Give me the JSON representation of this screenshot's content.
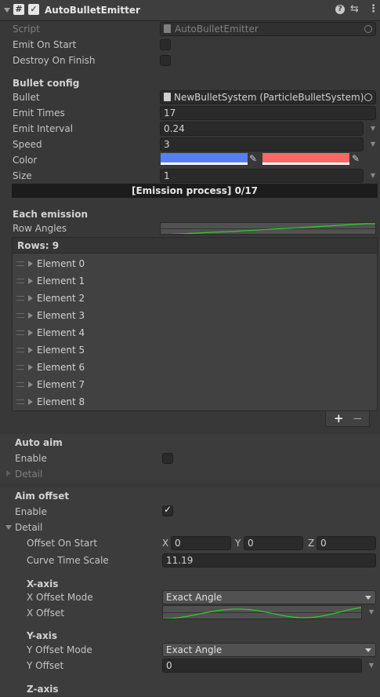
{
  "component": {
    "title": "AutoBulletEmitter",
    "script_label": "Script",
    "script_value": "AutoBulletEmitter"
  },
  "base": {
    "emit_on_start_label": "Emit On Start",
    "emit_on_start": false,
    "destroy_on_finish_label": "Destroy On Finish",
    "destroy_on_finish": false
  },
  "bullet_config": {
    "header": "Bullet config",
    "bullet_label": "Bullet",
    "bullet_value": "NewBulletSystem (ParticleBulletSystem)",
    "emit_times_label": "Emit Times",
    "emit_times": "17",
    "emit_interval_label": "Emit Interval",
    "emit_interval": "0.24",
    "speed_label": "Speed",
    "speed": "3",
    "color_label": "Color",
    "color_start": "#5580f0",
    "color_end": "#ff6666",
    "size_label": "Size",
    "size": "1"
  },
  "progress": {
    "text": "[Emission process] 0/17",
    "fraction": 0
  },
  "each_emission": {
    "header": "Each emission",
    "row_angles_label": "Row Angles",
    "rows_header": "Rows: 9",
    "elements": [
      "Element 0",
      "Element 1",
      "Element 2",
      "Element 3",
      "Element 4",
      "Element 5",
      "Element 6",
      "Element 7",
      "Element 8"
    ],
    "add_label": "+",
    "remove_label": "−"
  },
  "auto_aim": {
    "header": "Auto aim",
    "enable_label": "Enable",
    "enable": false,
    "detail_label": "Detail"
  },
  "aim_offset": {
    "header": "Aim offset",
    "enable_label": "Enable",
    "enable": true,
    "detail_label": "Detail",
    "offset_on_start_label": "Offset On Start",
    "x_label": "X",
    "x_value": "0",
    "y_label": "Y",
    "y_value": "0",
    "z_label": "Z",
    "z_value": "0",
    "curve_time_scale_label": "Curve Time Scale",
    "curve_time_scale": "11.19",
    "x_axis_header": "X-axis",
    "x_offset_mode_label": "X Offset Mode",
    "x_offset_mode": "Exact Angle",
    "x_offset_label": "X Offset",
    "y_axis_header": "Y-axis",
    "y_offset_mode_label": "Y Offset Mode",
    "y_offset_mode": "Exact Angle",
    "y_offset_label": "Y Offset",
    "y_offset": "0",
    "z_axis_header": "Z-axis"
  },
  "colors": {
    "accent_curve": "#2fd02f",
    "panel": "#383838",
    "field": "#2a2a2a"
  }
}
